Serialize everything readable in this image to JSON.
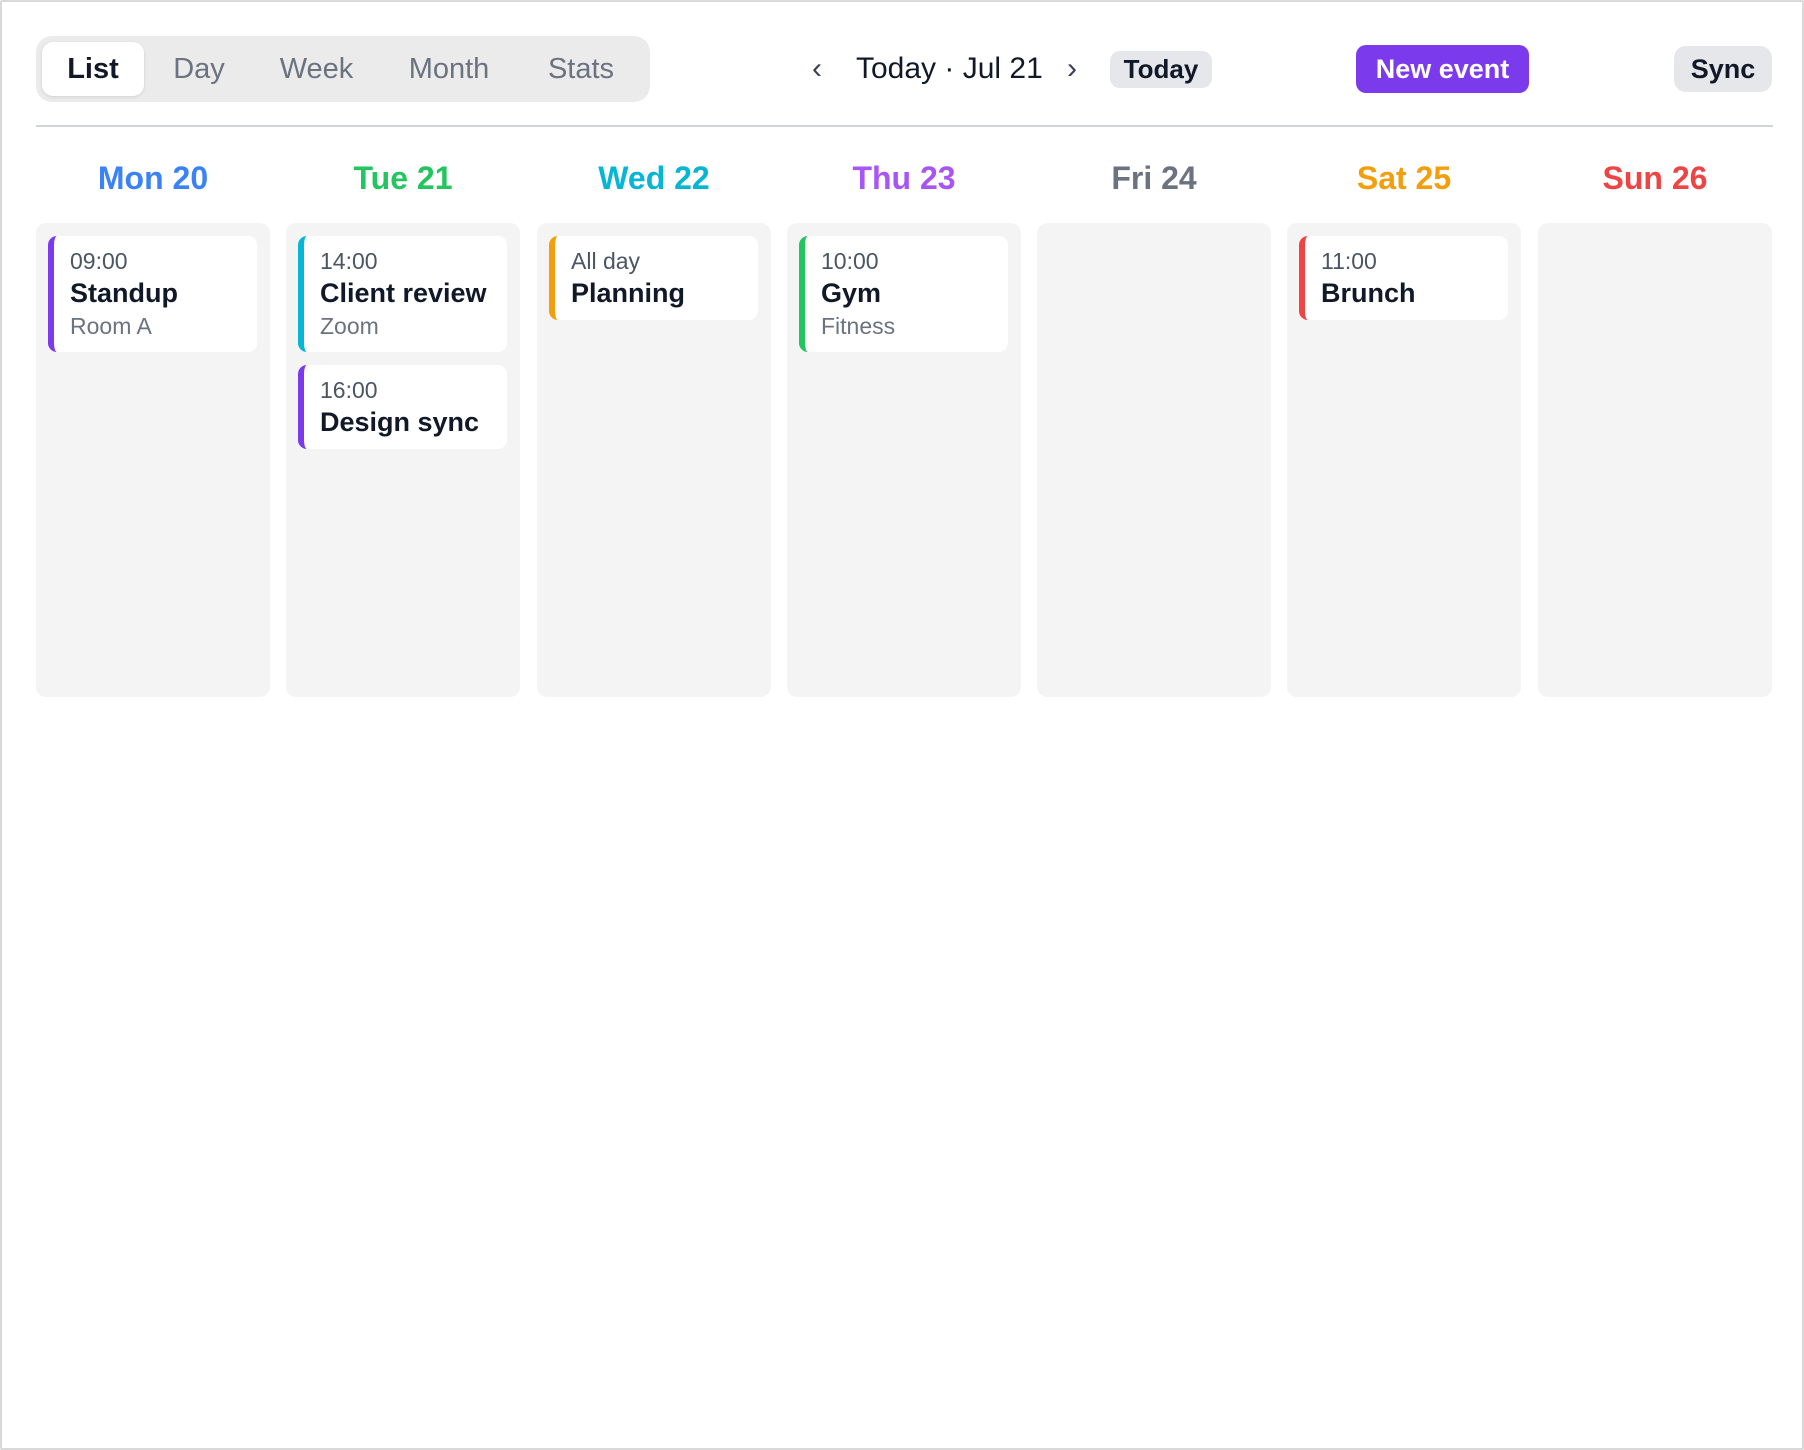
{
  "views": {
    "tabs": [
      {
        "label": "List",
        "active": true
      },
      {
        "label": "Day",
        "active": false
      },
      {
        "label": "Week",
        "active": false
      },
      {
        "label": "Month",
        "active": false
      },
      {
        "label": "Stats",
        "active": false
      }
    ]
  },
  "nav": {
    "prev_symbol": "‹",
    "next_symbol": "›",
    "current_label": "Today · Jul 21",
    "today_label": "Today"
  },
  "actions": {
    "new_event_label": "New event",
    "sync_label": "Sync"
  },
  "colors": {
    "accent": "#7c3aed",
    "mon": "#3b82f6",
    "tue": "#22c55e",
    "wed": "#06b6d4",
    "thu": "#a855f7",
    "fri": "#6b7280",
    "sat": "#f59e0b",
    "sun": "#ef4444",
    "event_purple": "#7c3aed",
    "event_cyan": "#06b6d4",
    "event_amber": "#f59e0b",
    "event_green": "#22c55e",
    "event_red": "#ef4444"
  },
  "days": [
    {
      "label": "Mon 20",
      "events": [
        {
          "time": "09:00",
          "title": "Standup",
          "sub": "Room A"
        }
      ]
    },
    {
      "label": "Tue 21",
      "events": [
        {
          "time": "14:00",
          "title": "Client review",
          "sub": "Zoom"
        },
        {
          "time": "16:00",
          "title": "Design sync",
          "sub": ""
        }
      ]
    },
    {
      "label": "Wed 22",
      "events": [
        {
          "time": "All day",
          "title": "Planning",
          "sub": ""
        }
      ]
    },
    {
      "label": "Thu 23",
      "events": [
        {
          "time": "10:00",
          "title": "Gym",
          "sub": "Fitness"
        }
      ]
    },
    {
      "label": "Fri 24",
      "events": []
    },
    {
      "label": "Sat 25",
      "events": [
        {
          "time": "11:00",
          "title": "Brunch",
          "sub": ""
        }
      ]
    },
    {
      "label": "Sun 26",
      "events": []
    }
  ]
}
